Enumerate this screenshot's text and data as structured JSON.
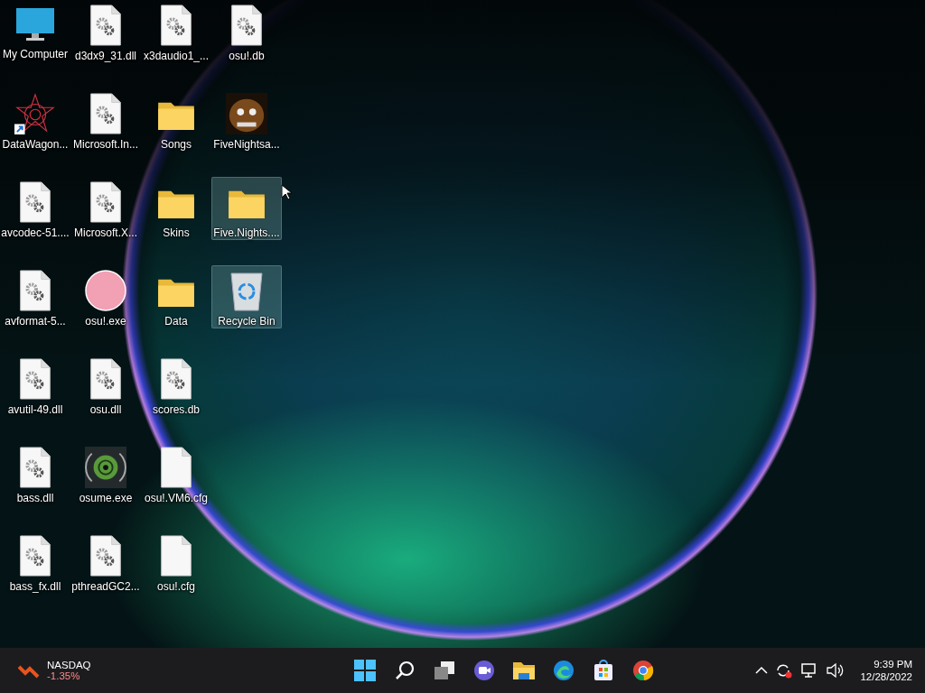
{
  "desktop": {
    "columns": [
      {
        "items": [
          {
            "kind": "computer",
            "label": "My Computer",
            "selected": false
          },
          {
            "kind": "shortcut",
            "label": "DataWagon...",
            "selected": false
          },
          {
            "kind": "dll",
            "label": "avcodec-51....",
            "selected": false
          },
          {
            "kind": "dll",
            "label": "avformat-5...",
            "selected": false
          },
          {
            "kind": "dll",
            "label": "avutil-49.dll",
            "selected": false
          },
          {
            "kind": "dll",
            "label": "bass.dll",
            "selected": false
          },
          {
            "kind": "dll",
            "label": "bass_fx.dll",
            "selected": false
          }
        ]
      },
      {
        "items": [
          {
            "kind": "dll",
            "label": "d3dx9_31.dll",
            "selected": false
          },
          {
            "kind": "dll",
            "label": "Microsoft.In...",
            "selected": false
          },
          {
            "kind": "dll",
            "label": "Microsoft.X...",
            "selected": false
          },
          {
            "kind": "osu",
            "label": "osu!.exe",
            "selected": false
          },
          {
            "kind": "dll",
            "label": "osu.dll",
            "selected": false
          },
          {
            "kind": "ring",
            "label": "osume.exe",
            "selected": false
          },
          {
            "kind": "dll",
            "label": "pthreadGC2...",
            "selected": false
          }
        ]
      },
      {
        "items": [
          {
            "kind": "dll",
            "label": "x3daudio1_...",
            "selected": false
          },
          {
            "kind": "folder",
            "label": "Songs",
            "selected": false
          },
          {
            "kind": "folder",
            "label": "Skins",
            "selected": false
          },
          {
            "kind": "folder",
            "label": "Data",
            "selected": false
          },
          {
            "kind": "dll",
            "label": "scores.db",
            "selected": false
          },
          {
            "kind": "blank",
            "label": "osu!.VM6.cfg",
            "selected": false
          },
          {
            "kind": "blank",
            "label": "osu!.cfg",
            "selected": false
          }
        ]
      },
      {
        "items": [
          {
            "kind": "dll",
            "label": "osu!.db",
            "selected": false
          },
          {
            "kind": "picture",
            "label": "FiveNightsa...",
            "selected": false
          },
          {
            "kind": "folder",
            "label": "Five.Nights....",
            "selected": true
          },
          {
            "kind": "recycle",
            "label": "Recycle Bin",
            "selected": true
          }
        ]
      }
    ]
  },
  "taskbar": {
    "widget": {
      "name": "NASDAQ",
      "change": "-1.35%"
    },
    "apps": [
      {
        "kind": "start"
      },
      {
        "kind": "search"
      },
      {
        "kind": "taskview"
      },
      {
        "kind": "chat"
      },
      {
        "kind": "explorer"
      },
      {
        "kind": "edge"
      },
      {
        "kind": "store"
      },
      {
        "kind": "chrome"
      }
    ],
    "tray": {
      "time": "9:39 PM",
      "date": "12/28/2022"
    }
  }
}
